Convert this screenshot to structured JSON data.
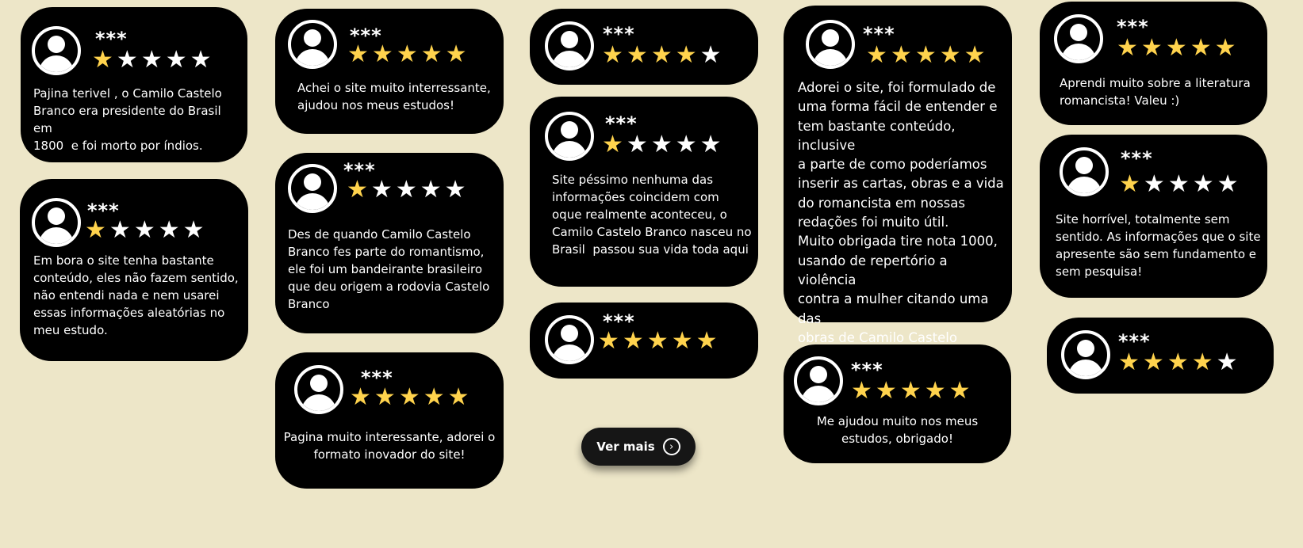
{
  "star_colors": {
    "filled": "#ffd34d",
    "empty": "#ffffff"
  },
  "icons": {
    "avatar": "user-avatar-icon",
    "star": "star-icon",
    "arrow": "chevron-right-circle-icon"
  },
  "ver_mais": {
    "label": "Ver mais"
  },
  "reviews": [
    {
      "name": "***",
      "rating": 1,
      "comment": "Pajina terivel , o Camilo Castelo\nBranco era presidente do Brasil em\n1800  e foi morto por índios."
    },
    {
      "name": "***",
      "rating": 1,
      "comment": "Em bora o site tenha bastante\nconteúdo, eles não fazem sentido,\nnão entendi nada e nem usarei\nessas informações aleatórias no\nmeu estudo."
    },
    {
      "name": "***",
      "rating": 5,
      "comment": "Achei o site muito interressante,\najudou nos meus estudos!"
    },
    {
      "name": "***",
      "rating": 1,
      "comment": "Des de quando Camilo Castelo\nBranco fes parte do romantismo,\nele foi um bandeirante brasileiro\nque deu origem a rodovia Castelo\nBranco"
    },
    {
      "name": "***",
      "rating": 5,
      "comment": "Pagina muito interessante, adorei o\nformato inovador do site!"
    },
    {
      "name": "***",
      "rating": 4,
      "comment": ""
    },
    {
      "name": "***",
      "rating": 1,
      "comment": "Site péssimo nenhuma das\ninformações coincidem com\noque realmente aconteceu, o\nCamilo Castelo Branco nasceu no\nBrasil  passou sua vida toda aqui"
    },
    {
      "name": "***",
      "rating": 5,
      "comment": ""
    },
    {
      "name": "***",
      "rating": 5,
      "comment": "Adorei o site, foi formulado de\numa forma fácil de entender e\ntem bastante conteúdo, inclusive\na parte de como poderíamos\ninserir as cartas, obras e a vida\ndo romancista em nossas\nredações foi muito útil.\nMuito obrigada tire nota 1000,\nusando de repertório a violência\ncontra a mulher citando uma das\nobras de Camilo Castelo Branco."
    },
    {
      "name": "***",
      "rating": 5,
      "comment": "Me ajudou muito nos meus\nestudos, obrigado!"
    },
    {
      "name": "***",
      "rating": 5,
      "comment": "Aprendi muito sobre a literatura\nromancista! Valeu :)"
    },
    {
      "name": "***",
      "rating": 1,
      "comment": "Site horrível, totalmente sem\nsentido. As informações que o site\napresente são sem fundamento e\nsem pesquisa!"
    },
    {
      "name": "***",
      "rating": 4,
      "comment": ""
    }
  ]
}
